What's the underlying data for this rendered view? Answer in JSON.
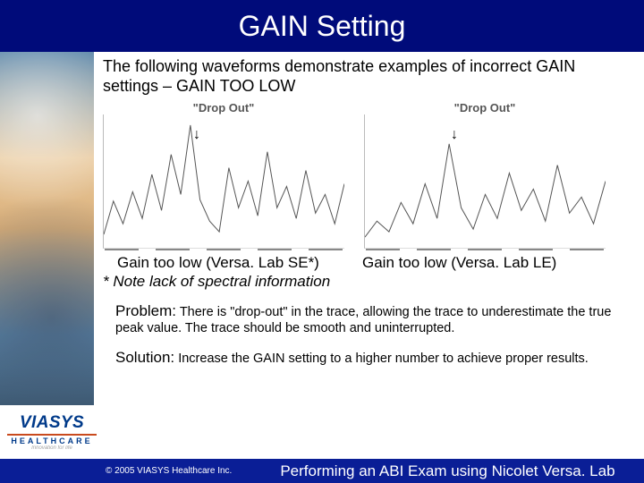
{
  "title": "GAIN Setting",
  "intro": "The following waveforms demonstrate examples of incorrect GAIN settings – GAIN TOO LOW",
  "charts": {
    "left_title": "\"Drop Out\"",
    "right_title": "\"Drop Out\"",
    "arrow_glyph": "↓"
  },
  "captions": {
    "left": "Gain too low (Versa. Lab SE*)",
    "right": "Gain too low (Versa. Lab LE)"
  },
  "note": "* Note lack of spectral information",
  "problem": {
    "heading": "Problem:",
    "body": "There is \"drop-out\" in the trace, allowing the trace to underestimate the true peak value.  The trace should be smooth and uninterrupted."
  },
  "solution": {
    "heading": "Solution:",
    "body": "Increase the GAIN setting to a higher number to achieve proper results."
  },
  "logo": {
    "brand": "VIASYS",
    "sub": "HEALTHCARE",
    "tag": "Innovation for life"
  },
  "footer": {
    "copyright": "© 2005 VIASYS Healthcare Inc.",
    "title": "Performing an ABI Exam using Nicolet Versa. Lab"
  },
  "chart_data": [
    {
      "type": "line",
      "title": "\"Drop Out\"",
      "xlabel": "",
      "ylabel": "",
      "ylim": [
        0,
        100
      ],
      "x": [
        0,
        4,
        8,
        12,
        16,
        20,
        24,
        28,
        32,
        36,
        40,
        44,
        48,
        52,
        56,
        60,
        64,
        68,
        72,
        76,
        80,
        84,
        88,
        92,
        96,
        100
      ],
      "values": [
        10,
        35,
        18,
        42,
        22,
        55,
        28,
        70,
        40,
        92,
        36,
        20,
        12,
        60,
        30,
        50,
        24,
        72,
        30,
        46,
        22,
        58,
        26,
        40,
        18,
        48
      ],
      "annotations": [
        {
          "label": "↓",
          "x": 40
        }
      ]
    },
    {
      "type": "line",
      "title": "\"Drop Out\"",
      "xlabel": "",
      "ylabel": "",
      "ylim": [
        0,
        100
      ],
      "x": [
        0,
        5,
        10,
        15,
        20,
        25,
        30,
        35,
        40,
        45,
        50,
        55,
        60,
        65,
        70,
        75,
        80,
        85,
        90,
        95,
        100
      ],
      "values": [
        8,
        20,
        12,
        34,
        18,
        48,
        22,
        78,
        30,
        14,
        40,
        22,
        56,
        28,
        44,
        20,
        62,
        26,
        38,
        18,
        50
      ],
      "annotations": [
        {
          "label": "↓",
          "x": 38
        }
      ]
    }
  ]
}
